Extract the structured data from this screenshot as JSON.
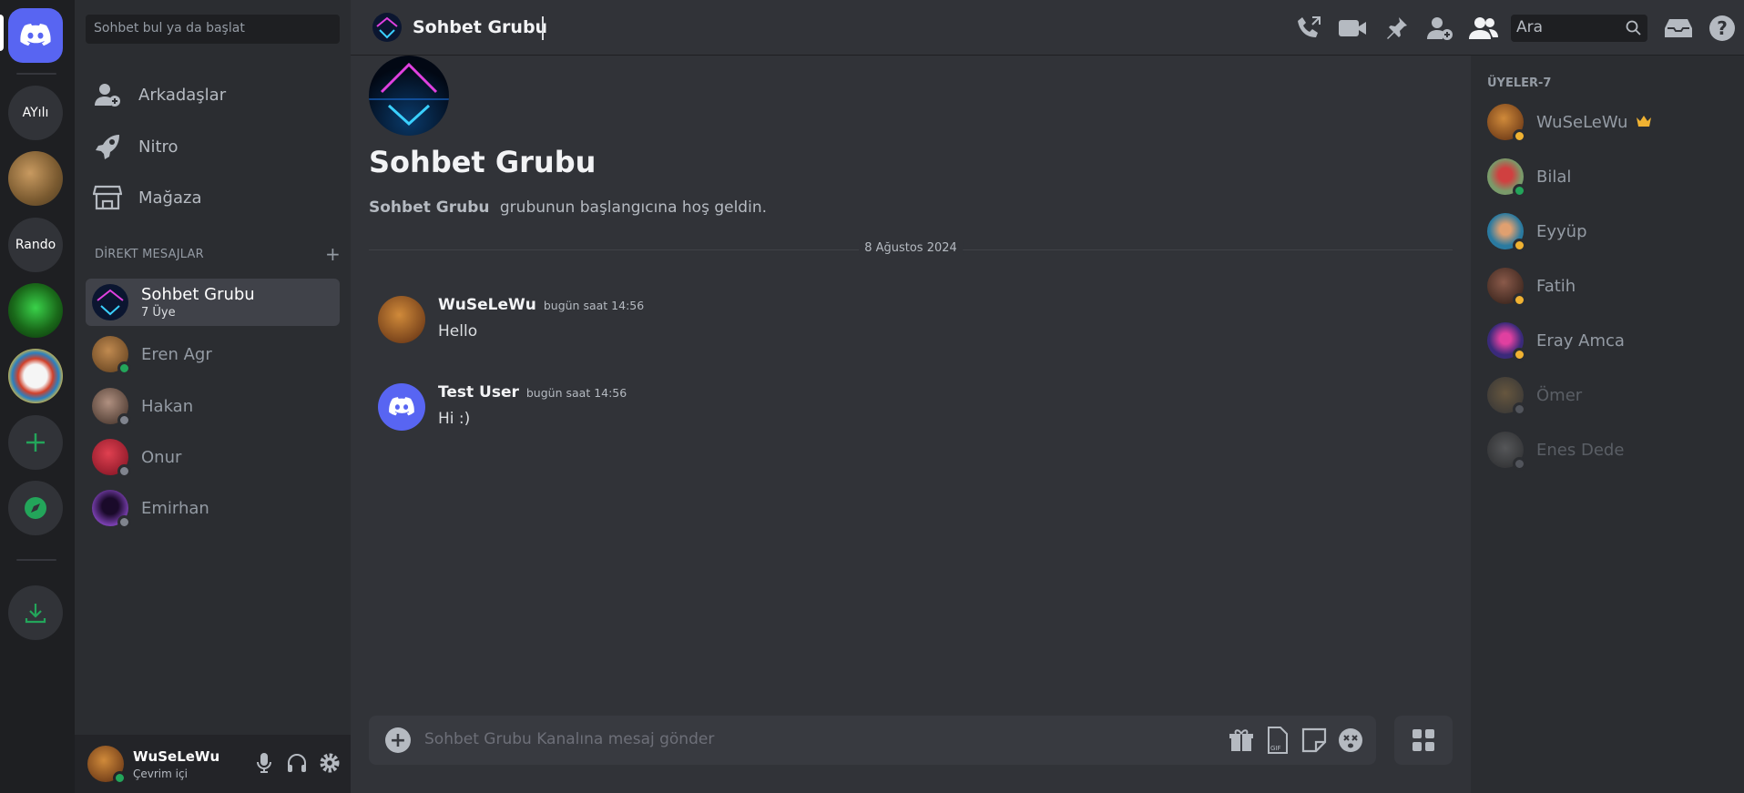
{
  "server_rail": {
    "items": [
      {
        "label": "AYılı"
      },
      {
        "label": "Rando"
      }
    ]
  },
  "sidebar": {
    "search_placeholder": "Sohbet bul ya da başlat",
    "nav": [
      {
        "label": "Arkadaşlar",
        "icon": "friends-icon"
      },
      {
        "label": "Nitro",
        "icon": "nitro-icon"
      },
      {
        "label": "Mağaza",
        "icon": "shop-icon"
      }
    ],
    "dm_header": "DİREKT MESAJLAR",
    "dm_add": "+",
    "dms": [
      {
        "name": "Sohbet Grubu",
        "sub": "7 Üye",
        "status": "none",
        "color": "#0b1630"
      },
      {
        "name": "Eren Agr",
        "status": "online",
        "color": "#7a5a2a"
      },
      {
        "name": "Hakan",
        "status": "offline",
        "color": "#6a4e44"
      },
      {
        "name": "Onur",
        "status": "offline",
        "color": "#c0283a"
      },
      {
        "name": "Emirhan",
        "status": "offline",
        "color": "#3a2050"
      }
    ]
  },
  "user_panel": {
    "name": "WuSeLeWu",
    "status_text": "Çevrim içi"
  },
  "header": {
    "title": "Sohbet Grubu",
    "search_placeholder": "Ara"
  },
  "chat": {
    "welcome_title": "Sohbet Grubu",
    "welcome_group": "Sohbet Grubu",
    "welcome_text": "grubunun başlangıcına hoş geldin.",
    "date_divider": "8 Ağustos 2024",
    "messages": [
      {
        "author": "WuSeLeWu",
        "time": "bugün saat 14:56",
        "text": "Hello"
      },
      {
        "author": "Test User",
        "time": "bugün saat 14:56",
        "text": "Hi :)"
      }
    ],
    "composer_placeholder": "Sohbet Grubu Kanalına mesaj gönder"
  },
  "members": {
    "header": "ÜYELER-7",
    "list": [
      {
        "name": "WuSeLeWu",
        "status": "idle",
        "owner": true,
        "color": "#8a4a1a"
      },
      {
        "name": "Bilal",
        "status": "online",
        "color": "#6f8a5a"
      },
      {
        "name": "Eyyüp",
        "status": "idle",
        "color": "#2a6a8a"
      },
      {
        "name": "Fatih",
        "status": "idle",
        "color": "#5a3a30"
      },
      {
        "name": "Eray Amca",
        "status": "idle",
        "color": "#4a2a6a"
      },
      {
        "name": "Ömer",
        "status": "offline",
        "color": "#6a5a4a"
      },
      {
        "name": "Enes Dede",
        "status": "offline",
        "color": "#4a4a4a"
      }
    ]
  },
  "colors": {
    "brand": "#5865f2",
    "green": "#23a55a",
    "idle": "#f0b232"
  }
}
